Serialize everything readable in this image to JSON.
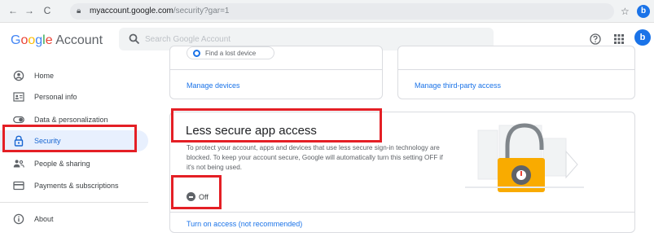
{
  "browser": {
    "nav": {
      "back": "←",
      "forward": "→",
      "reload": "C"
    },
    "url_host": "myaccount.google.com",
    "url_path": "/security?gar=1",
    "profile_initial": "b"
  },
  "header": {
    "brand_google": [
      "G",
      "o",
      "o",
      "g",
      "l",
      "e"
    ],
    "brand_account": "Account",
    "search_placeholder": "Search Google Account",
    "avatar_initial": "b"
  },
  "sidebar": {
    "items": [
      {
        "label": "Home",
        "icon": "home-icon",
        "active": false
      },
      {
        "label": "Personal info",
        "icon": "person-card-icon",
        "active": false
      },
      {
        "label": "Data & personalization",
        "icon": "toggle-icon",
        "active": false
      },
      {
        "label": "Security",
        "icon": "lock-icon",
        "active": true
      },
      {
        "label": "People & sharing",
        "icon": "people-icon",
        "active": false
      },
      {
        "label": "Payments & subscriptions",
        "icon": "credit-card-icon",
        "active": false
      },
      {
        "label": "About",
        "icon": "info-icon",
        "active": false
      }
    ]
  },
  "cards": {
    "devices": {
      "chip": "Find a lost device",
      "link": "Manage devices"
    },
    "third_party": {
      "link": "Manage third-party access"
    },
    "less_secure": {
      "title": "Less secure app access",
      "description": "To protect your account, apps and devices that use less secure sign-in technology are blocked. To keep your account secure, Google will automatically turn this setting OFF if it's not being used.",
      "status": "Off",
      "action_link": "Turn on access (not recommended)"
    }
  },
  "colors": {
    "accent": "#1a73e8",
    "highlight": "#e41f25",
    "active_bg": "#e8f0fe"
  }
}
